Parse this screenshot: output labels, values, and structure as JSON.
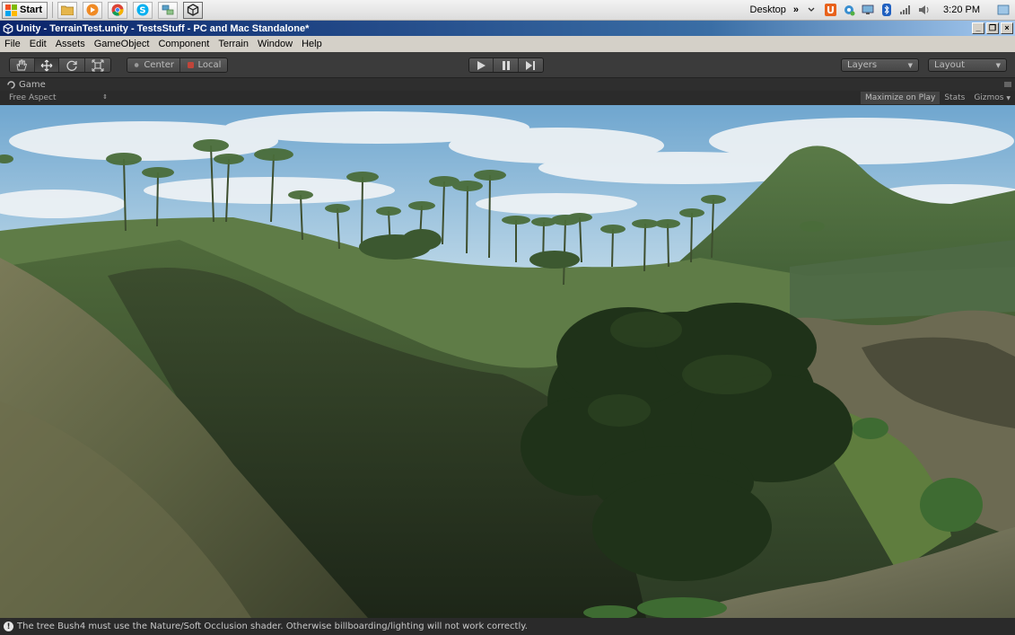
{
  "taskbar": {
    "start_label": "Start",
    "desktop_label": "Desktop",
    "overflow_glyph": "»",
    "clock": "3:20 PM",
    "apps": [
      {
        "name": "explorer-app",
        "icon": "folder-icon",
        "color": "#e6b64b"
      },
      {
        "name": "media-player-app",
        "icon": "media-play-icon",
        "color": "#f08a24"
      },
      {
        "name": "chrome-app",
        "icon": "chrome-icon",
        "color": "#db4437"
      },
      {
        "name": "skype-app",
        "icon": "skype-icon",
        "color": "#00aff0"
      },
      {
        "name": "network-app",
        "icon": "network-icon",
        "color": "#5aa0c8"
      },
      {
        "name": "unity-app",
        "icon": "unity-icon",
        "color": "#222222"
      }
    ]
  },
  "window": {
    "title": "Unity - TerrainTest.unity - TestsStuff - PC and Mac Standalone*",
    "minimize_glyph": "_",
    "restore_glyph": "❐",
    "close_glyph": "×"
  },
  "menu": {
    "items": [
      "File",
      "Edit",
      "Assets",
      "GameObject",
      "Component",
      "Terrain",
      "Window",
      "Help"
    ]
  },
  "toolbar": {
    "pivot_center": "Center",
    "pivot_local": "Local",
    "layers_label": "Layers",
    "layout_label": "Layout"
  },
  "game": {
    "tab_label": "Game",
    "aspect_label": "Free Aspect",
    "maximize_label": "Maximize on Play",
    "stats_label": "Stats",
    "gizmos_label": "Gizmos"
  },
  "status": {
    "message": "The tree Bush4 must use the Nature/Soft Occlusion shader. Otherwise billboarding/lighting will not work correctly."
  },
  "colors": {
    "sky_top": "#6fa6cf",
    "sky_bottom": "#cfe3ef",
    "grass": "#5e7a45",
    "rock": "#6f7254",
    "dark_tree": "#1f3219"
  }
}
